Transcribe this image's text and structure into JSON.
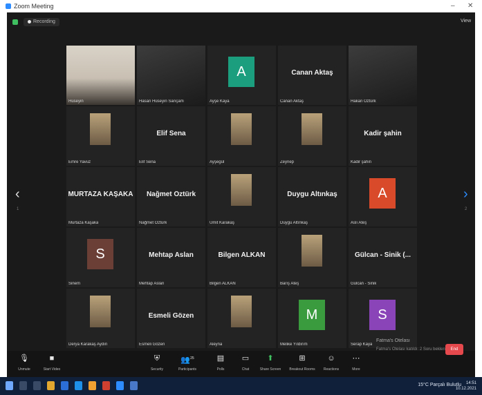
{
  "window": {
    "title": "Zoom Meeting",
    "minimize": "–",
    "close": "✕"
  },
  "topbar": {
    "recording_label": "Recording",
    "view_label": "View"
  },
  "participants": [
    {
      "label": "Hüseyin",
      "type": "video",
      "active": true
    },
    {
      "label": "Hasan Hüseyin Sarıçam",
      "type": "video"
    },
    {
      "label": "Ayşe Kaya",
      "type": "initial",
      "initial": "A",
      "color": "#1a9e7e"
    },
    {
      "label": "Canan Aktaş",
      "type": "name",
      "name": "Canan Aktaş"
    },
    {
      "label": "Hakan Öztürk",
      "type": "video"
    },
    {
      "label": "Emre Yavuz",
      "type": "thumb"
    },
    {
      "label": "Elif Sena",
      "type": "name",
      "name": "Elif Sena"
    },
    {
      "label": "Ayşegül",
      "type": "thumb"
    },
    {
      "label": "Zeynep",
      "type": "thumb"
    },
    {
      "label": "Kadir şahin",
      "type": "name",
      "name": "Kadir şahin"
    },
    {
      "label": "Murtaza Kaşaka",
      "type": "name",
      "name": "MURTAZA KAŞAKA"
    },
    {
      "label": "Nağmet Öztürk",
      "type": "name",
      "name": "Nağmet Öztürk"
    },
    {
      "label": "Ümit Karakaş",
      "type": "thumb"
    },
    {
      "label": "Duygu Altınkaş",
      "type": "name",
      "name": "Duygu Altınkaş"
    },
    {
      "label": "Aslı Ateş",
      "type": "initial",
      "initial": "A",
      "color": "#d84a2a"
    },
    {
      "label": "Sinem",
      "type": "initial",
      "initial": "S",
      "color": "#6b3f36"
    },
    {
      "label": "Mehtap Aslan",
      "type": "name",
      "name": "Mehtap Aslan"
    },
    {
      "label": "Bilgen ALKAN",
      "type": "name",
      "name": "Bilgen ALKAN"
    },
    {
      "label": "Barış Ateş",
      "type": "thumb"
    },
    {
      "label": "Gülcan - Sinik",
      "type": "name",
      "name": "Gülcan - Sinik (..."
    },
    {
      "label": "Derya Karakaş Aydın",
      "type": "thumb"
    },
    {
      "label": "Esmeli Gözen",
      "type": "name",
      "name": "Esmeli Gözen"
    },
    {
      "label": "Aleyna",
      "type": "thumb"
    },
    {
      "label": "Melike Yıldırım",
      "type": "initial",
      "initial": "M",
      "color": "#3a9a3e"
    },
    {
      "label": "Serap Kaya",
      "type": "initial",
      "initial": "S",
      "color": "#8a44b8"
    }
  ],
  "pagination": {
    "left": "1",
    "right": "2"
  },
  "toolbar": {
    "unmute": "Unmute",
    "start_video": "Start Video",
    "security": "Security",
    "participants": "Participants",
    "participants_count": "25",
    "polls": "Polls",
    "chat": "Chat",
    "share_screen": "Share Screen",
    "breakout_rooms": "Breakout Rooms",
    "reactions": "Reactions",
    "more": "More",
    "end": "End"
  },
  "toast": {
    "line1": "Fatma's Otelası",
    "line2": "Fatma's Otelası katıldı: 2 Soru bekleniyor"
  },
  "taskbar": {
    "tray_text": "15°C Parçalı Bulutlu",
    "time": "14:51",
    "date": "10.12.2021"
  }
}
